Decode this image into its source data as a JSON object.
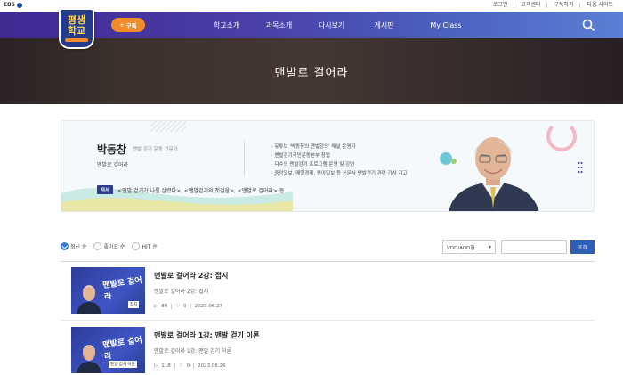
{
  "topbar": {
    "brand": "EBS",
    "links": [
      "로그인",
      "고객센터",
      "구독하기",
      "다음 사이트"
    ]
  },
  "nav": {
    "logo_line1": "평생",
    "logo_line2": "학교",
    "subscribe_label": "구독",
    "menu": [
      "학교소개",
      "과목소개",
      "다시보기",
      "게시판",
      "My Class"
    ]
  },
  "hero": {
    "title": "맨발로 걸어라"
  },
  "profile": {
    "name": "박동창",
    "role": "맨발 걷기 운동 전문가",
    "book": "맨발로 걸어라",
    "bullets": [
      "유튜브 '박동창의 맨발강의' 채널 운영자",
      "맨발걷기국민운동본부 창립",
      "다수의 맨발걷기 프로그램 운영 및 강연",
      "중앙일보, 매일경제, 동아일보 등 신문사 맨발걷기 관련 기사 기고"
    ],
    "author_tag": "저서",
    "works": "<맨발 걷기가 나를 살렸다>, <맨발걷기의 첫걸음>, <맨발로 걸어라> 등"
  },
  "filters": {
    "options": [
      "최신 순",
      "좋아요 순",
      "HIT 순"
    ],
    "selected": 0,
    "select_value": "VOD/AOD형",
    "search_value": "",
    "search_button": "조회"
  },
  "items": [
    {
      "title": "맨발로 걸어라 2강: 접지",
      "subtitle": "맨발로 걸어라 2강: 접지",
      "views": "80",
      "likes": "0",
      "date": "2023.06.27",
      "thumb_title": "맨발로 걸어라",
      "thumb_badge": "접지"
    },
    {
      "title": "맨발로 걸어라 1강: 맨발 걷기 이론",
      "subtitle": "맨발로 걸어라 1강: 맨발 걷기 이론",
      "views": "118",
      "likes": "0",
      "date": "2023.06.26",
      "thumb_title": "맨발로 걸어라",
      "thumb_badge": "맨발 걷기 이론"
    }
  ],
  "colors": {
    "nav_start": "#3f2a90",
    "nav_end": "#5a7fd4",
    "accent_orange": "#f28c28",
    "button_blue": "#2c5fb5"
  }
}
